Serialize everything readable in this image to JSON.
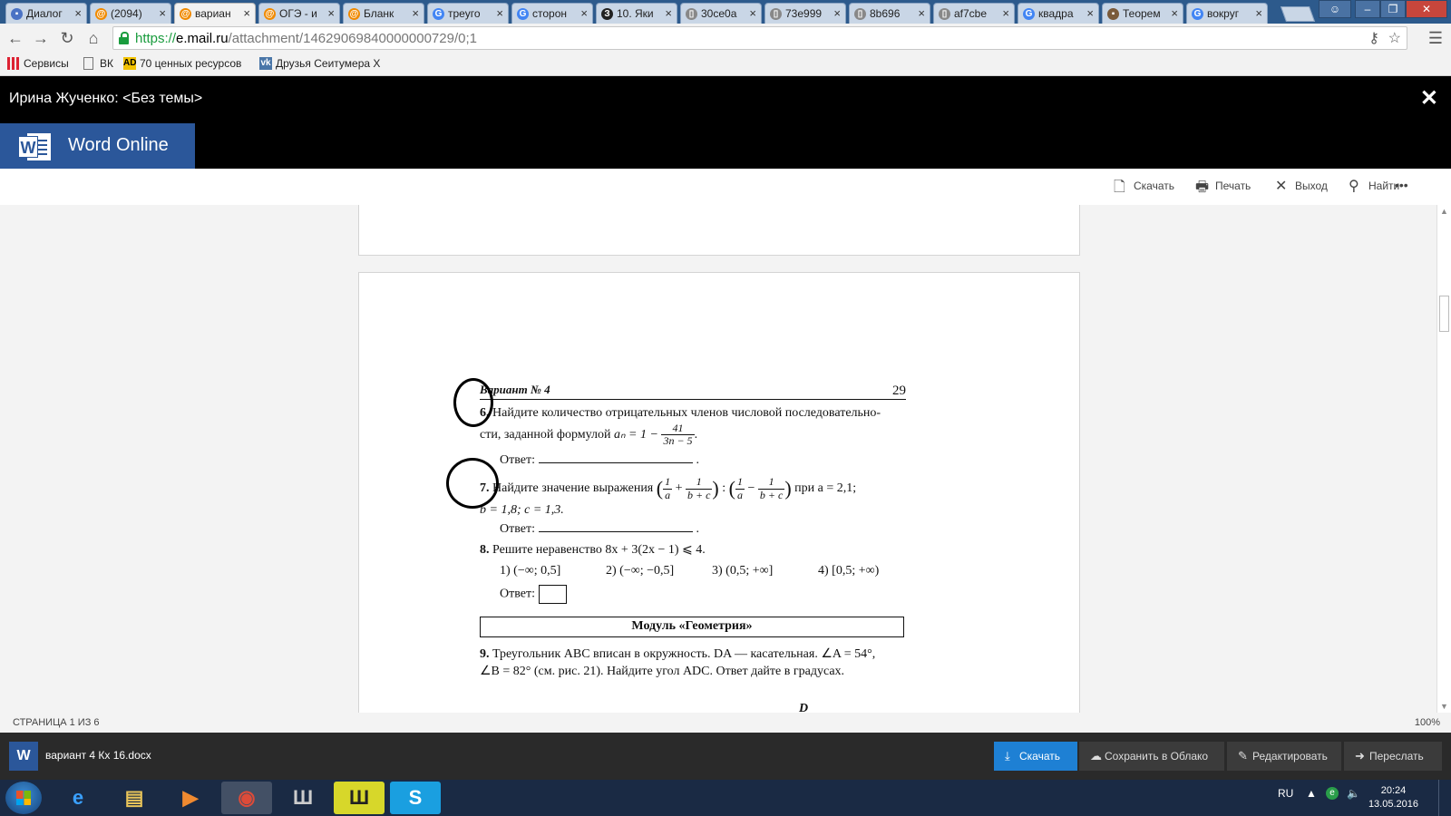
{
  "browser": {
    "tabs": [
      {
        "label": "Диалог",
        "icon_color": "#4a72c4",
        "icon": "chat"
      },
      {
        "label": "(2094)",
        "icon_color": "#f08a00",
        "icon": "at"
      },
      {
        "label": "вариан",
        "icon_color": "#f08a00",
        "icon": "at"
      },
      {
        "label": "ОГЭ - и",
        "icon_color": "#f08a00",
        "icon": "at"
      },
      {
        "label": "Бланк",
        "icon_color": "#f08a00",
        "icon": "at"
      },
      {
        "label": "треуго",
        "icon_color": "#4285f4",
        "icon": "google"
      },
      {
        "label": "сторон",
        "icon_color": "#4285f4",
        "icon": "google"
      },
      {
        "label": "10. Яки",
        "icon_color": "#222222",
        "icon": "z"
      },
      {
        "label": "30ce0a",
        "icon_color": "#888888",
        "icon": "doc"
      },
      {
        "label": "73e999",
        "icon_color": "#888888",
        "icon": "doc"
      },
      {
        "label": "8b696",
        "icon_color": "#888888",
        "icon": "doc"
      },
      {
        "label": "af7cbe",
        "icon_color": "#888888",
        "icon": "doc"
      },
      {
        "label": "квадра",
        "icon_color": "#4285f4",
        "icon": "google"
      },
      {
        "label": "Теорем",
        "icon_color": "#7a5a3a",
        "icon": "img"
      },
      {
        "label": "вокруг",
        "icon_color": "#4285f4",
        "icon": "google"
      }
    ],
    "active_tab": 2,
    "url": {
      "scheme": "https://",
      "host": "e.mail.ru",
      "path": "/attachment/14629069840000000729/0;1"
    },
    "bookmarks": [
      {
        "label": "Сервисы",
        "icon": "apps-icon",
        "icon_text": ""
      },
      {
        "label": "ВК",
        "icon": "page-icon",
        "icon_text": ""
      },
      {
        "label": "70 ценных ресурсов",
        "icon": "ad-icon",
        "icon_text": "AD"
      },
      {
        "label": "Друзья Сеитумера Х",
        "icon": "vk-icon",
        "icon_text": "vk"
      }
    ]
  },
  "viewer": {
    "title": "Ирина Жученко: <Без темы>",
    "close_glyph": "✕",
    "app_name": "Word Online",
    "commands": [
      {
        "label": "Скачать",
        "icon": "download-icon",
        "glyph": "🗋"
      },
      {
        "label": "Печать",
        "icon": "print-icon",
        "glyph": "🖶"
      },
      {
        "label": "Выход",
        "icon": "exit-icon",
        "glyph": "✕"
      },
      {
        "label": "Найти",
        "icon": "search-icon",
        "glyph": "⚲"
      }
    ],
    "more_glyph": "•••"
  },
  "document": {
    "variant": "Вариант № 4",
    "page_number": "29",
    "q6": {
      "num": "6.",
      "text1": "Найдите количество отрицательных членов числовой последовательно-",
      "text2": "сти, заданной формулой ",
      "formula": "aₙ = 1 − ",
      "frac_num": "41",
      "frac_den": "3n − 5",
      "tail": "."
    },
    "answer_label": "Ответ:",
    "q7": {
      "num": "7.",
      "text1": "Найдите значение выражения",
      "expr_tail": "при a = 2,1;",
      "text2": "b = 1,8; c = 1,3.",
      "f1_num": "1",
      "f1_den": "a",
      "f2_num": "1",
      "f2_den": "b + c",
      "f3_num": "1",
      "f3_den": "a",
      "f4_num": "1",
      "f4_den": "b + c",
      "op_plus": "+",
      "op_div": ":",
      "op_minus": "−",
      "lparen": "(",
      "rparen": ")"
    },
    "q8": {
      "num": "8.",
      "text": "Решите неравенство 8x + 3(2x − 1) ⩽ 4.",
      "options": [
        "1) (−∞; 0,5]",
        "2) (−∞; −0,5]",
        "3) (0,5; +∞]",
        "4) [0,5; +∞)"
      ]
    },
    "module_title": "Модуль «Геометрия»",
    "q9": {
      "num": "9.",
      "text1": "Треугольник ABC вписан в окружность. DA — касательная. ∠A = 54°,",
      "text2": "∠B = 82° (см. рис. 21). Найдите угол ADC. Ответ дайте в градусах."
    },
    "figure_label": "D"
  },
  "status": {
    "page_info": "СТРАНИЦА 1 ИЗ 6",
    "zoom": "100%"
  },
  "attachment": {
    "filename": "вариант 4 Кх 16.docx",
    "buttons": [
      {
        "label": "Скачать",
        "icon": "download-icon",
        "glyph": "⤓"
      },
      {
        "label": "Сохранить в Облако",
        "icon": "cloud-icon",
        "glyph": "☁"
      },
      {
        "label": "Редактировать",
        "icon": "edit-icon",
        "glyph": "✎"
      },
      {
        "label": "Переслать",
        "icon": "forward-icon",
        "glyph": "➜"
      }
    ]
  },
  "taskbar": {
    "apps": [
      {
        "name": "internet-explorer-icon",
        "glyph": "e",
        "color": "#3aa0ff"
      },
      {
        "name": "file-explorer-icon",
        "glyph": "▤",
        "color": "#e8c45a"
      },
      {
        "name": "media-player-icon",
        "glyph": "▶",
        "color": "#f08a30"
      },
      {
        "name": "chrome-icon",
        "glyph": "◉",
        "color": "#dd4b39"
      },
      {
        "name": "world-of-tanks-icon",
        "glyph": "Ш",
        "color": "#cccccc"
      },
      {
        "name": "world-of-tanks-alt-icon",
        "glyph": "Ш",
        "color": "#222222"
      },
      {
        "name": "skype-icon",
        "glyph": "S",
        "color": "#ffffff"
      }
    ],
    "lang": "RU",
    "time": "20:24",
    "date": "13.05.2016"
  }
}
